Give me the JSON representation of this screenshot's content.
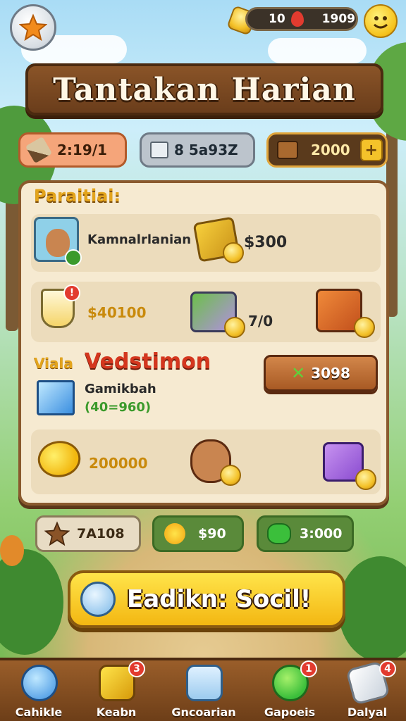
{
  "header": {
    "resource_value": "10",
    "resource_total": "1909"
  },
  "banner": {
    "title": "Tantakan Harian"
  },
  "stats": [
    {
      "icon": "brush-icon",
      "value": "2:19/1"
    },
    {
      "icon": "gift-icon",
      "value": "8 5a93Z"
    },
    {
      "icon": "chest-icon",
      "value": "2000"
    }
  ],
  "panel": {
    "title": "Paraitiai:",
    "row1": {
      "label": "Kamnalrlanian",
      "reward": "$300"
    },
    "row2": {
      "reward_a": "$40100",
      "reward_b": "7/0"
    },
    "row3": {
      "prefix": "Viala",
      "title": "Vedstimon",
      "subtitle": "Gamikbah",
      "progress": "(40=960)",
      "button": "3098"
    },
    "row4": {
      "reward": "200000"
    }
  },
  "chips": [
    {
      "icon": "star-icon",
      "value": "7A108"
    },
    {
      "icon": "sun-icon",
      "value": "$90"
    },
    {
      "icon": "clover-icon",
      "value": "3:000"
    }
  ],
  "cta": {
    "label": "Eadikn: Socil!"
  },
  "bottom_nav": [
    {
      "label": "Cahikle",
      "icon": "pencil-icon",
      "badge": ""
    },
    {
      "label": "Keabn",
      "icon": "cheese-box-icon",
      "badge": "3"
    },
    {
      "label": "Gncoarian",
      "icon": "calendar-icon",
      "badge": ""
    },
    {
      "label": "Gapoeis",
      "icon": "green-smiley-icon",
      "badge": "1"
    },
    {
      "label": "Dalyal",
      "icon": "paper-plane-icon",
      "badge": "4"
    }
  ],
  "colors": {
    "accent_green": "#3b9a2b",
    "title_red": "#d4361e",
    "gold": "#f4c22a",
    "wood": "#8a5428"
  }
}
